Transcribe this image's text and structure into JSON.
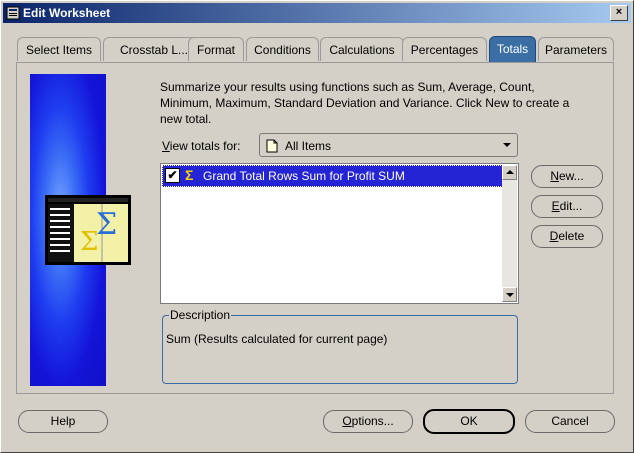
{
  "window": {
    "title": "Edit Worksheet",
    "close_glyph": "×"
  },
  "tabs": [
    {
      "label": "Select Items",
      "active": false
    },
    {
      "label": "Crosstab L...",
      "active": false
    },
    {
      "label": "Format",
      "active": false
    },
    {
      "label": "Conditions",
      "active": false
    },
    {
      "label": "Calculations",
      "active": false
    },
    {
      "label": "Percentages",
      "active": false
    },
    {
      "label": "Totals",
      "active": true
    },
    {
      "label": "Parameters",
      "active": false
    }
  ],
  "intro_text": "Summarize your results using functions such as Sum, Average, Count, Minimum, Maximum, Standard Deviation and Variance.  Click New to create a new total.",
  "view_totals": {
    "label_prefix": "V",
    "label_rest": "iew totals for:",
    "selected": "All Items"
  },
  "totals_list": {
    "items": [
      {
        "label": "Grand Total Rows Sum for Profit SUM",
        "checked": true,
        "icon": "sigma-icon",
        "selected": true
      }
    ],
    "check_glyph": "✔",
    "sigma_glyph": "Σ"
  },
  "side_buttons": {
    "new_mnemonic": "N",
    "new_rest": "ew...",
    "edit_mnemonic": "E",
    "edit_rest": "dit...",
    "delete_mnemonic": "D",
    "delete_rest": "elete"
  },
  "description": {
    "legend": "Description",
    "text": "Sum (Results calculated for current page)"
  },
  "footer_buttons": {
    "help": "Help",
    "options_mnemonic": "O",
    "options_rest": "ptions...",
    "ok": "OK",
    "cancel": "Cancel"
  },
  "colors": {
    "titlebar_start": "#0a246a",
    "titlebar_end": "#a6caf0",
    "active_tab": "#3a6ea5",
    "selection": "#2424d4",
    "graphic_blue": "#1414d8",
    "sigma_yellow": "#ffd400"
  }
}
